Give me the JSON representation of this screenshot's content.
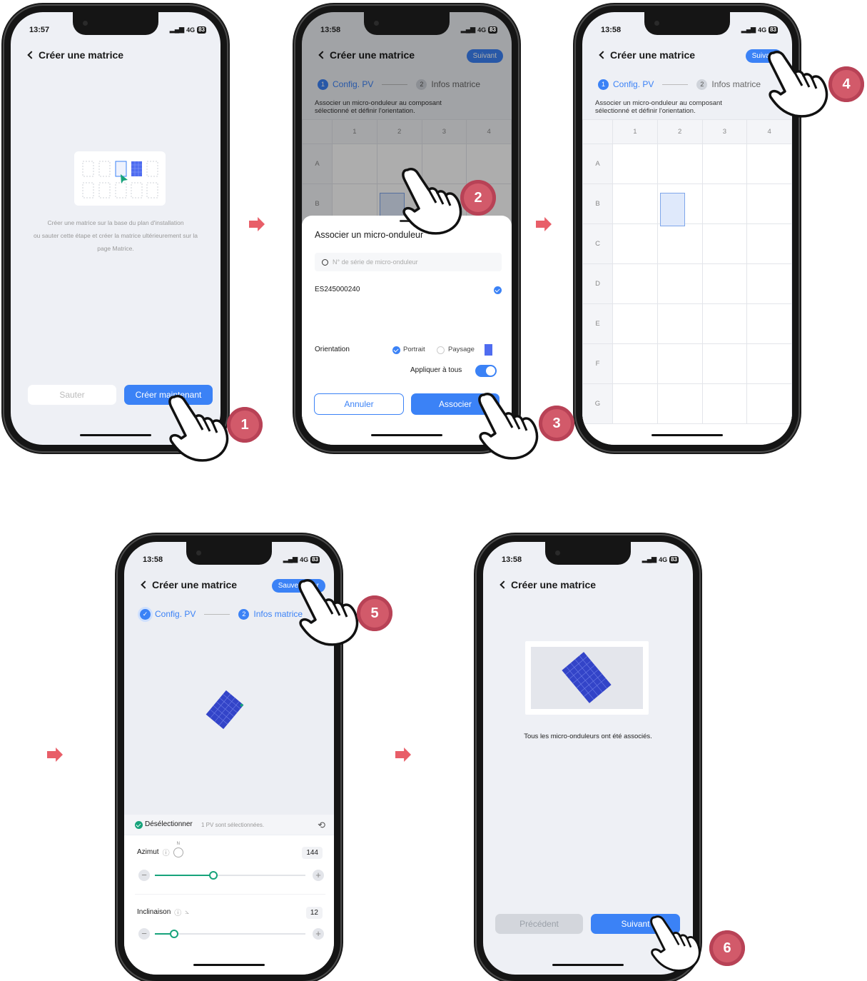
{
  "common": {
    "title": "Créer une matrice",
    "net": "4G",
    "battery": "83"
  },
  "phone1": {
    "time": "13:57",
    "info": [
      "Créer une matrice sur la base du plan d'installation",
      "ou sauter cette étape et créer la matrice ultérieurement sur la",
      "page Matrice."
    ],
    "skip": "Sauter",
    "create": "Créer maintenant"
  },
  "phone2": {
    "time": "13:58",
    "next": "Suivant",
    "step1": "Config. PV",
    "step2": "Infos matrice",
    "desc1": "Associer un micro-onduleur au composant",
    "desc2": "sélectionné et définir l'orientation.",
    "cols": [
      "1",
      "2",
      "3",
      "4"
    ],
    "rows": [
      "A",
      "B"
    ],
    "sheet_title": "Associer un micro-onduleur",
    "search_placeholder": "N° de série de micro-onduleur",
    "serial": "ES245000240",
    "orientation": "Orientation",
    "portrait": "Portrait",
    "landscape": "Paysage",
    "apply_all": "Appliquer à tous",
    "cancel": "Annuler",
    "associate": "Associer"
  },
  "phone3": {
    "time": "13:58",
    "next": "Suivant",
    "step1": "Config. PV",
    "step2": "Infos matrice",
    "desc1": "Associer un micro-onduleur au composant",
    "desc2": "sélectionné et définir l'orientation.",
    "cols": [
      "1",
      "2",
      "3",
      "4"
    ],
    "rows": [
      "A",
      "B",
      "C",
      "D",
      "E",
      "F",
      "G"
    ]
  },
  "phone4": {
    "time": "13:58",
    "save": "Sauvegarder",
    "step1": "Config. PV",
    "step2": "Infos matrice",
    "deselect": "Désélectionner",
    "selected": "1 PV sont sélectionnées.",
    "azimuth": "Azimut",
    "azimuth_value": "144",
    "azimuth_fraction": 0.42,
    "tilt": "Inclinaison",
    "tilt_value": "12",
    "tilt_fraction": 0.14,
    "compass_n": "N"
  },
  "phone5": {
    "time": "13:58",
    "done": "Tous les micro-onduleurs ont été associés.",
    "prev": "Précédent",
    "next": "Suivant"
  },
  "badges": [
    "1",
    "2",
    "3",
    "4",
    "5",
    "6"
  ],
  "colors": {
    "primary": "#3b82f6",
    "accent": "#17a37b",
    "arrow": "#e85e68",
    "badge": "#d25a6a"
  }
}
